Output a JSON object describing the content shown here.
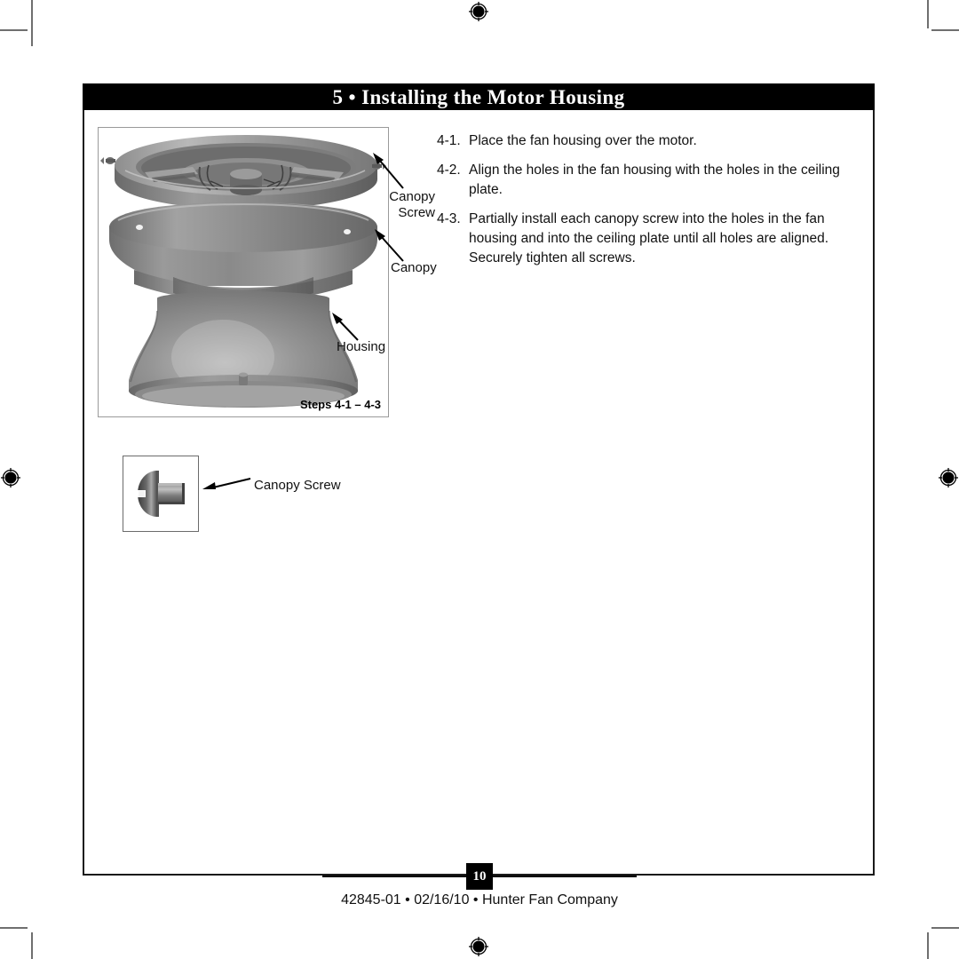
{
  "document": {
    "section_number": "5",
    "section_title": "5 • Installing the Motor Housing"
  },
  "illustration": {
    "caption": "Steps 4-1 – 4-3",
    "labels": {
      "canopy_screw_line1": "Canopy",
      "canopy_screw_line2": "Screw",
      "canopy": "Canopy",
      "housing": "Housing"
    }
  },
  "instructions": [
    {
      "number": "4-1.",
      "text": "Place the fan housing over the motor."
    },
    {
      "number": "4-2.",
      "text": "Align the holes in the fan housing with the holes in the ceiling plate."
    },
    {
      "number": "4-3.",
      "text": "Partially install each canopy screw into the holes in the fan housing and into the ceiling plate until all holes are aligned. Securely tighten all screws."
    }
  ],
  "parts": {
    "canopy_screw_label": "Canopy Screw"
  },
  "footer": {
    "page_number": "10",
    "text": "42845-01  •  02/16/10  •  Hunter Fan Company"
  },
  "colors": {
    "header_bar": "#000000",
    "header_text": "#ffffff",
    "frame_border": "#1a1a1a",
    "body_text": "#111111",
    "crop_mark": "#6f6f6f",
    "metal_light": "#b4b4b4",
    "metal_mid": "#8d8d8d",
    "metal_dark": "#5e5e5e"
  }
}
